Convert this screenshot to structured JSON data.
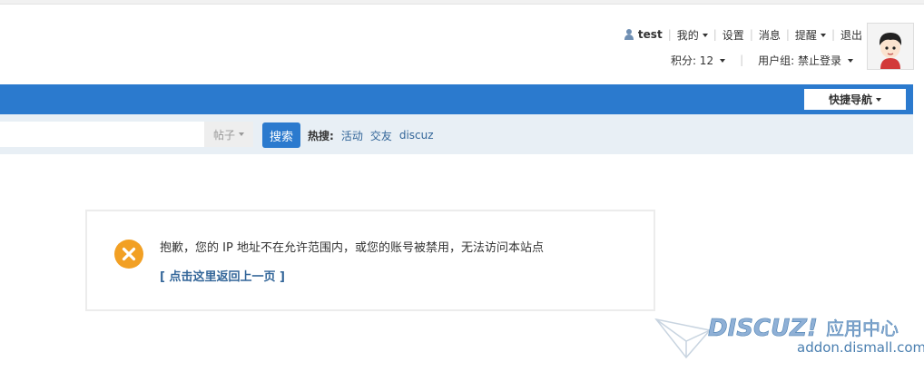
{
  "userbar": {
    "username": "test",
    "my_label": "我的",
    "settings_label": "设置",
    "messages_label": "消息",
    "reminders_label": "提醒",
    "logout_label": "退出",
    "points_label": "积分: 12",
    "usergroup_label": "用户组: 禁止登录"
  },
  "nav": {
    "quick_nav_label": "快捷导航"
  },
  "search": {
    "input_value": "",
    "type_label": "帖子",
    "button_label": "搜索",
    "hot_label": "热搜:",
    "hot_items": [
      "活动",
      "交友",
      "discuz"
    ]
  },
  "message": {
    "text": "抱歉，您的 IP 地址不在允许范围内，或您的账号被禁用，无法访问本站点",
    "back_link": "[ 点击这里返回上一页 ]",
    "icon": "error-x-icon"
  },
  "watermark": {
    "brand": "DISCUZ!",
    "brand_cn": "应用中心",
    "domain": "addon.dismall.com"
  },
  "colors": {
    "nav_blue": "#2b7ace",
    "search_bg": "#e8eff5",
    "error_orange": "#f2a024",
    "link_blue": "#336699"
  }
}
